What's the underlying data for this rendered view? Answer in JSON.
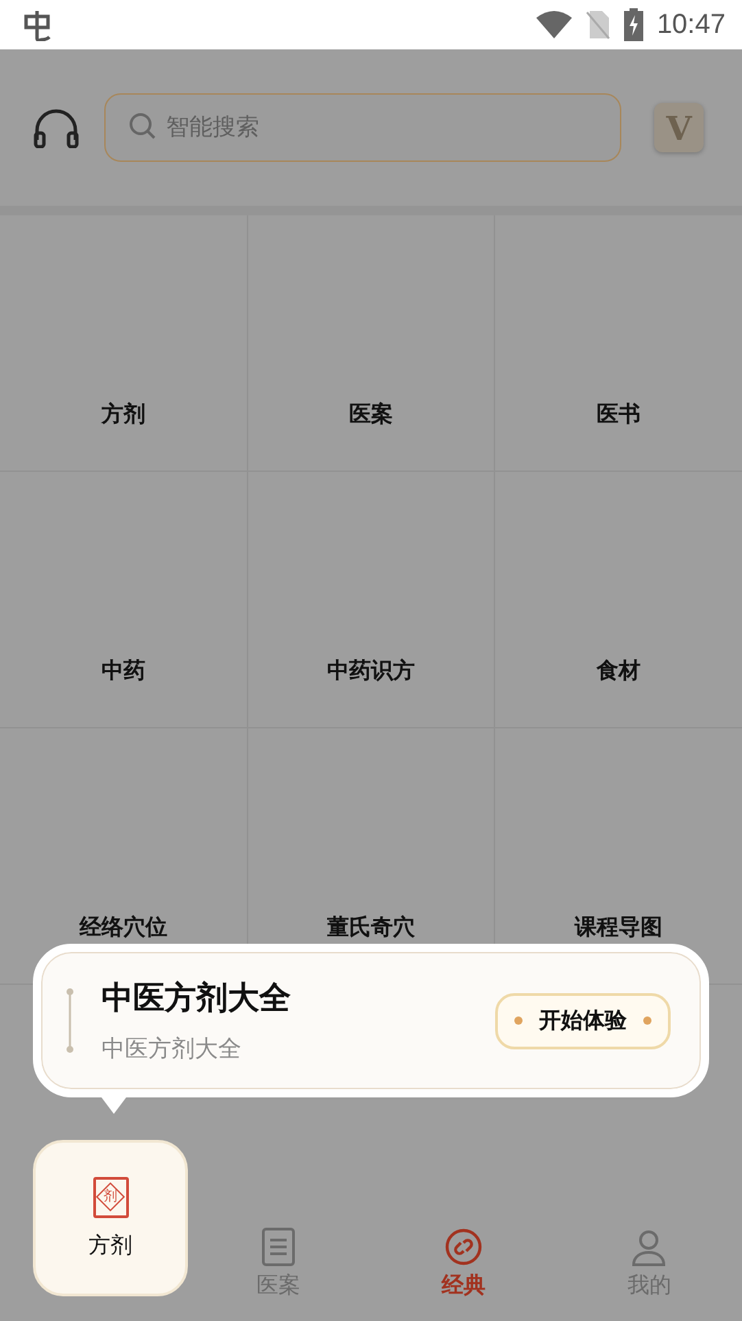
{
  "status_bar": {
    "time": "10:47"
  },
  "header": {
    "search": {
      "placeholder": "智能搜索"
    },
    "vip_badge": "V"
  },
  "grid": [
    {
      "label": "方剂"
    },
    {
      "label": "医案"
    },
    {
      "label": "医书"
    },
    {
      "label": "中药"
    },
    {
      "label": "中药识方"
    },
    {
      "label": "食材"
    },
    {
      "label": "经络穴位"
    },
    {
      "label": "董氏奇穴"
    },
    {
      "label": "课程导图"
    }
  ],
  "guide": {
    "title": "中医方剂大全",
    "subtitle": "中医方剂大全",
    "button": "开始体验",
    "tab": {
      "label": "方剂",
      "icon_glyph": "剂"
    }
  },
  "nav": [
    {
      "label": "医案",
      "kind": "document",
      "selected": false
    },
    {
      "label": "经典",
      "kind": "link",
      "selected": true
    },
    {
      "label": "我的",
      "kind": "person",
      "selected": false
    }
  ]
}
